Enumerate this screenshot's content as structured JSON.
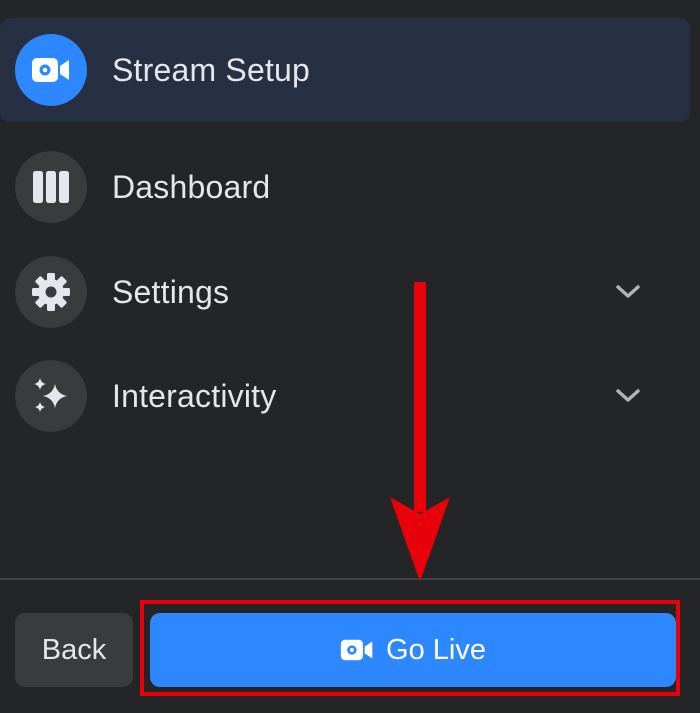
{
  "nav": {
    "items": [
      {
        "label": "Stream Setup",
        "icon": "video-camera-icon",
        "active": true
      },
      {
        "label": "Dashboard",
        "icon": "columns-icon",
        "active": false
      },
      {
        "label": "Settings",
        "icon": "gear-icon",
        "active": false,
        "expandable": true
      },
      {
        "label": "Interactivity",
        "icon": "sparkle-icon",
        "active": false,
        "expandable": true
      }
    ]
  },
  "footer": {
    "back_label": "Back",
    "go_live_label": "Go Live"
  },
  "colors": {
    "background": "#242526",
    "active_item": "#263042",
    "accent": "#2d88ff",
    "icon_bg": "#3a3b3c",
    "text": "#e4e6eb",
    "annotation": "#e8000a"
  }
}
